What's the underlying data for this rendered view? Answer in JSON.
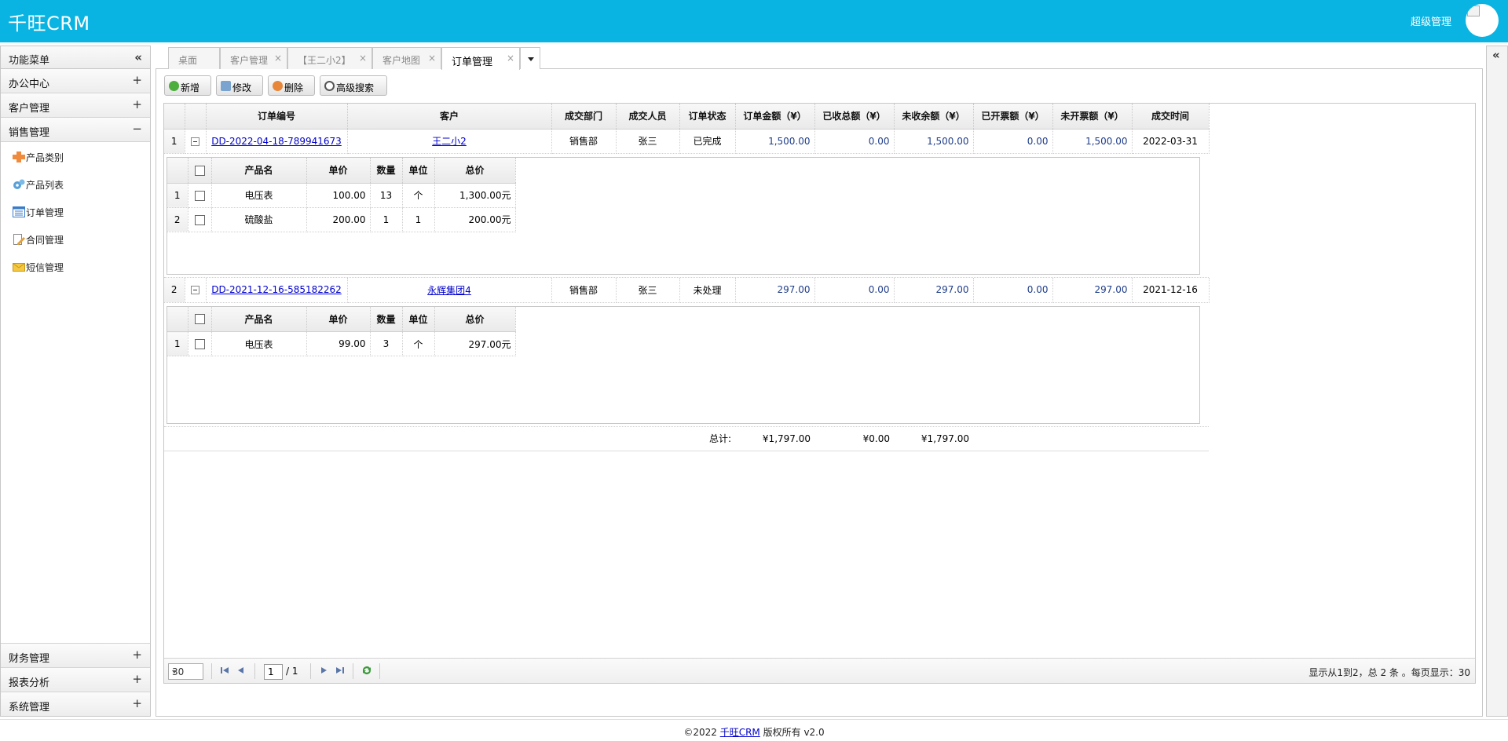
{
  "header": {
    "app_title": "千旺CRM",
    "user_name": "超级管理"
  },
  "sidebar": {
    "title": "功能菜单",
    "collapse_icon": "«",
    "sections_top": [
      {
        "label": "办公中心",
        "tool": "+"
      },
      {
        "label": "客户管理",
        "tool": "+"
      },
      {
        "label": "销售管理",
        "tool": "−"
      }
    ],
    "menu_items": [
      {
        "label": "产品类别",
        "icon": "plus-cross-icon"
      },
      {
        "label": "产品列表",
        "icon": "gears-icon"
      },
      {
        "label": "订单管理",
        "icon": "list-window-icon"
      },
      {
        "label": "合同管理",
        "icon": "edit-document-icon"
      },
      {
        "label": "短信管理",
        "icon": "envelope-icon"
      }
    ],
    "sections_bottom": [
      {
        "label": "财务管理",
        "tool": "+"
      },
      {
        "label": "报表分析",
        "tool": "+"
      },
      {
        "label": "系统管理",
        "tool": "+"
      }
    ]
  },
  "right_strip": {
    "expand_icon": "«"
  },
  "tabs": [
    {
      "label": "桌面",
      "closable": false
    },
    {
      "label": "客户管理",
      "closable": true
    },
    {
      "label": "【王二小2】",
      "closable": true
    },
    {
      "label": "客户地图",
      "closable": true
    },
    {
      "label": "订单管理",
      "closable": true,
      "active": true
    }
  ],
  "close_glyph": "×",
  "toolbar": {
    "add": "新增",
    "edit": "修改",
    "delete": "删除",
    "search": "高级搜索"
  },
  "grid": {
    "columns": [
      "订单编号",
      "客户",
      "成交部门",
      "成交人员",
      "订单状态",
      "订单金额（¥）",
      "已收总额（¥）",
      "未收余额（¥）",
      "已开票额（¥）",
      "未开票额（¥）",
      "成交时间"
    ],
    "detail_columns": [
      "产品名",
      "单价",
      "数量",
      "单位",
      "总价"
    ],
    "orders": [
      {
        "index": "1",
        "order_no": "DD-2022-04-18-789941673",
        "customer": "王二小2",
        "dept": "销售部",
        "person": "张三",
        "status": "已完成",
        "amount": "1,500.00",
        "received": "0.00",
        "unreceived": "1,500.00",
        "invoiced": "0.00",
        "uninvoiced": "1,500.00",
        "date": "2022-03-31",
        "items": [
          {
            "index": "1",
            "name": "电压表",
            "price": "100.00",
            "qty": "13",
            "unit": "个",
            "total": "1,300.00元"
          },
          {
            "index": "2",
            "name": "硫酸盐",
            "price": "200.00",
            "qty": "1",
            "unit": "1",
            "total": "200.00元"
          }
        ]
      },
      {
        "index": "2",
        "order_no": "DD-2021-12-16-585182262",
        "customer": "永辉集团4",
        "dept": "销售部",
        "person": "张三",
        "status": "未处理",
        "amount": "297.00",
        "received": "0.00",
        "unreceived": "297.00",
        "invoiced": "0.00",
        "uninvoiced": "297.00",
        "date": "2021-12-16",
        "items": [
          {
            "index": "1",
            "name": "电压表",
            "price": "99.00",
            "qty": "3",
            "unit": "个",
            "total": "297.00元"
          }
        ]
      }
    ],
    "footer": {
      "label": "总计:",
      "amount": "¥1,797.00",
      "received": "¥0.00",
      "unreceived": "¥1,797.00"
    }
  },
  "pager": {
    "page_size": "30",
    "current_page": "1",
    "total_pages": "/ 1",
    "info": "显示从1到2，总 2 条 。每页显示：30"
  },
  "footer": {
    "prefix": "©2022",
    "link": "千旺CRM",
    "suffix": "版权所有 v2.0"
  }
}
